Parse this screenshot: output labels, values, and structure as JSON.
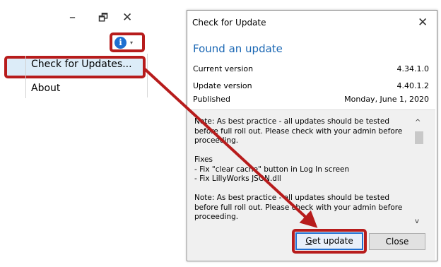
{
  "main_window": {
    "minimize_glyph": "–",
    "restore_glyph": "🗗",
    "close_glyph": "✕",
    "info_icon": "info-icon",
    "info_glyph": "i",
    "caret_glyph": "▾",
    "menu": {
      "check_for_updates": "Check for Updates...",
      "about": "About"
    }
  },
  "dialog": {
    "title": "Check for Update",
    "close_glyph": "✕",
    "heading": "Found an update",
    "current_version_label": "Current version",
    "current_version_value": "4.34.1.0",
    "update_version_label": "Update version",
    "update_version_value": "4.40.1.2",
    "published_label": "Published",
    "published_value": "Monday, June 1, 2020",
    "notes": {
      "note1": [
        "Note: As best practice - all updates should be tested",
        "before full roll out. Please check with your admin before",
        "proceeding."
      ],
      "fixes": [
        "Fixes",
        " - Fix \"clear cache\" button in Log In screen",
        " - Fix LillyWorks JSON.dll"
      ],
      "note2": [
        "Note: As best practice - all updates should be tested",
        "before full roll out. Please check with your admin before",
        "proceeding."
      ]
    },
    "scroll_up_glyph": "^",
    "scroll_down_glyph": "v",
    "get_update_first": "G",
    "get_update_rest": "et update",
    "close_button": "Close"
  },
  "colors": {
    "highlight": "#b71c1c",
    "heading": "#1a67b4",
    "primary_button_border": "#1f6fd1",
    "info_icon": "#1e6fd0"
  }
}
